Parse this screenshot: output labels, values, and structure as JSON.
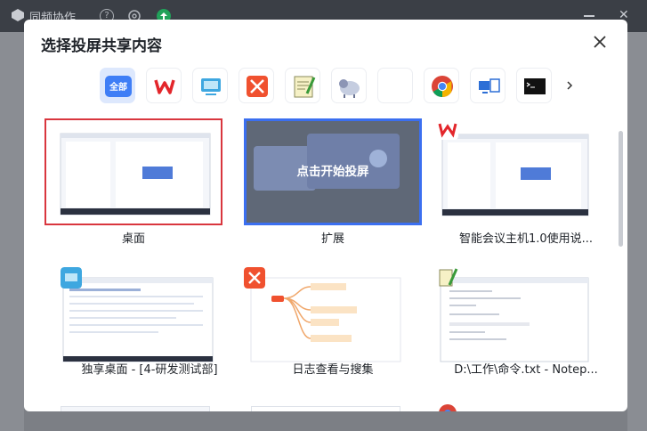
{
  "background_app": {
    "title": "同频协作"
  },
  "dialog": {
    "title": "选择投屏共享内容"
  },
  "app_filter": {
    "all_label": "全部",
    "apps": [
      "wps-icon",
      "remote-desktop-icon",
      "xmind-icon",
      "notepad-plus-icon",
      "sheep-icon",
      "blank-app-icon",
      "chrome-icon",
      "monitor-app-icon",
      "terminal-icon"
    ]
  },
  "shares": [
    {
      "label": "桌面",
      "state": "selected"
    },
    {
      "label": "扩展",
      "state": "hover",
      "hover_text": "点击开始投屏"
    },
    {
      "label": "智能会议主机1.0使用说..."
    },
    {
      "label": "独享桌面 - [4-研发测试部]"
    },
    {
      "label": "日志查看与搜集"
    },
    {
      "label": "D:\\工作\\命令.txt - Notep..."
    }
  ],
  "colors": {
    "accent": "#3b6ff0",
    "selected_border": "#d9363e"
  }
}
